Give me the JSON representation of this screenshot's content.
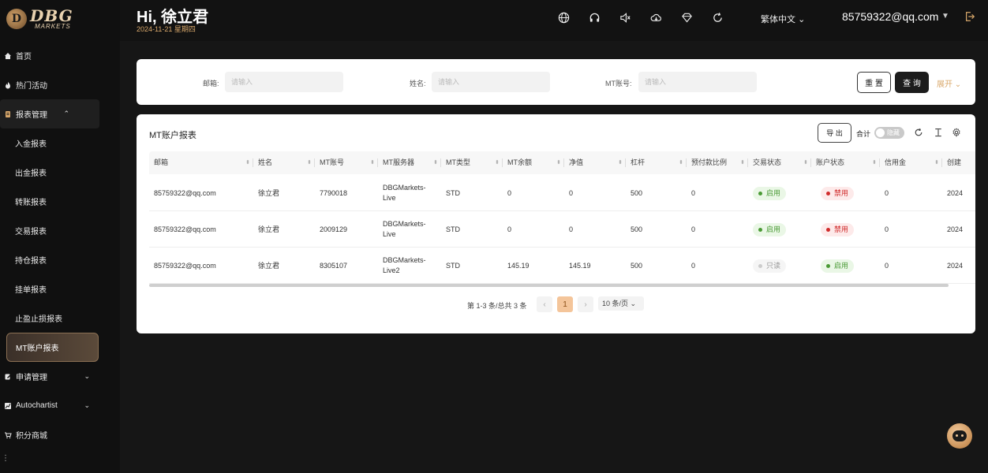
{
  "brand": {
    "name": "DBG",
    "sub": "MARKETS"
  },
  "header": {
    "greeting": "Hi, 徐立君",
    "date": "2024-11-21 星期四",
    "language": "繁体中文",
    "user_email": "85759322@qq.com",
    "icons": [
      "globe-icon",
      "headset-icon",
      "mute-icon",
      "cloud-download-icon",
      "diamond-icon",
      "refresh-icon"
    ]
  },
  "sidebar": {
    "items": [
      {
        "label": "首页",
        "icon": "home-icon"
      },
      {
        "label": "热门活动",
        "icon": "fire-icon"
      },
      {
        "label": "报表管理",
        "icon": "report-icon"
      },
      {
        "label": "入金报表"
      },
      {
        "label": "出金报表"
      },
      {
        "label": "转账报表"
      },
      {
        "label": "交易报表"
      },
      {
        "label": "持仓报表"
      },
      {
        "label": "挂单报表"
      },
      {
        "label": "止盈止损报表"
      },
      {
        "label": "MT账户报表"
      },
      {
        "label": "申请管理",
        "icon": "apply-icon"
      },
      {
        "label": "Autochartist",
        "icon": "chart-icon"
      },
      {
        "label": "积分商城",
        "icon": "cart-icon"
      }
    ]
  },
  "filter": {
    "email_label": "邮箱:",
    "name_label": "姓名:",
    "mt_label": "MT账号:",
    "placeholder": "请输入",
    "reset": "重 置",
    "query": "查 询",
    "expand": "展开"
  },
  "table": {
    "title": "MT账户报表",
    "export": "导 出",
    "total_label": "合计",
    "toggle_label": "隐藏",
    "columns": [
      "邮箱",
      "姓名",
      "MT账号",
      "MT服务器",
      "MT类型",
      "MT余额",
      "净值",
      "杠杆",
      "预付款比例",
      "交易状态",
      "账户状态",
      "信用金",
      "创建"
    ],
    "rows": [
      {
        "email": "85759322@qq.com",
        "name": "徐立君",
        "mt": "7790018",
        "server": "DBGMarkets-Live",
        "type": "STD",
        "balance": "0",
        "equity": "0",
        "leverage": "500",
        "margin": "0",
        "trade_status": "启用",
        "trade_color": "green",
        "acct_status": "禁用",
        "acct_color": "red",
        "credit": "0",
        "created": "2024"
      },
      {
        "email": "85759322@qq.com",
        "name": "徐立君",
        "mt": "2009129",
        "server": "DBGMarkets-Live",
        "type": "STD",
        "balance": "0",
        "equity": "0",
        "leverage": "500",
        "margin": "0",
        "trade_status": "启用",
        "trade_color": "green",
        "acct_status": "禁用",
        "acct_color": "red",
        "credit": "0",
        "created": "2024"
      },
      {
        "email": "85759322@qq.com",
        "name": "徐立君",
        "mt": "8305107",
        "server": "DBGMarkets-Live2",
        "type": "STD",
        "balance": "145.19",
        "equity": "145.19",
        "leverage": "500",
        "margin": "0",
        "trade_status": "只读",
        "trade_color": "gray",
        "acct_status": "启用",
        "acct_color": "green",
        "credit": "0",
        "created": "2024"
      }
    ]
  },
  "pager": {
    "summary": "第 1-3 条/总共 3 条",
    "prev": "‹",
    "current": "1",
    "next": "›",
    "page_size": "10 条/页"
  }
}
